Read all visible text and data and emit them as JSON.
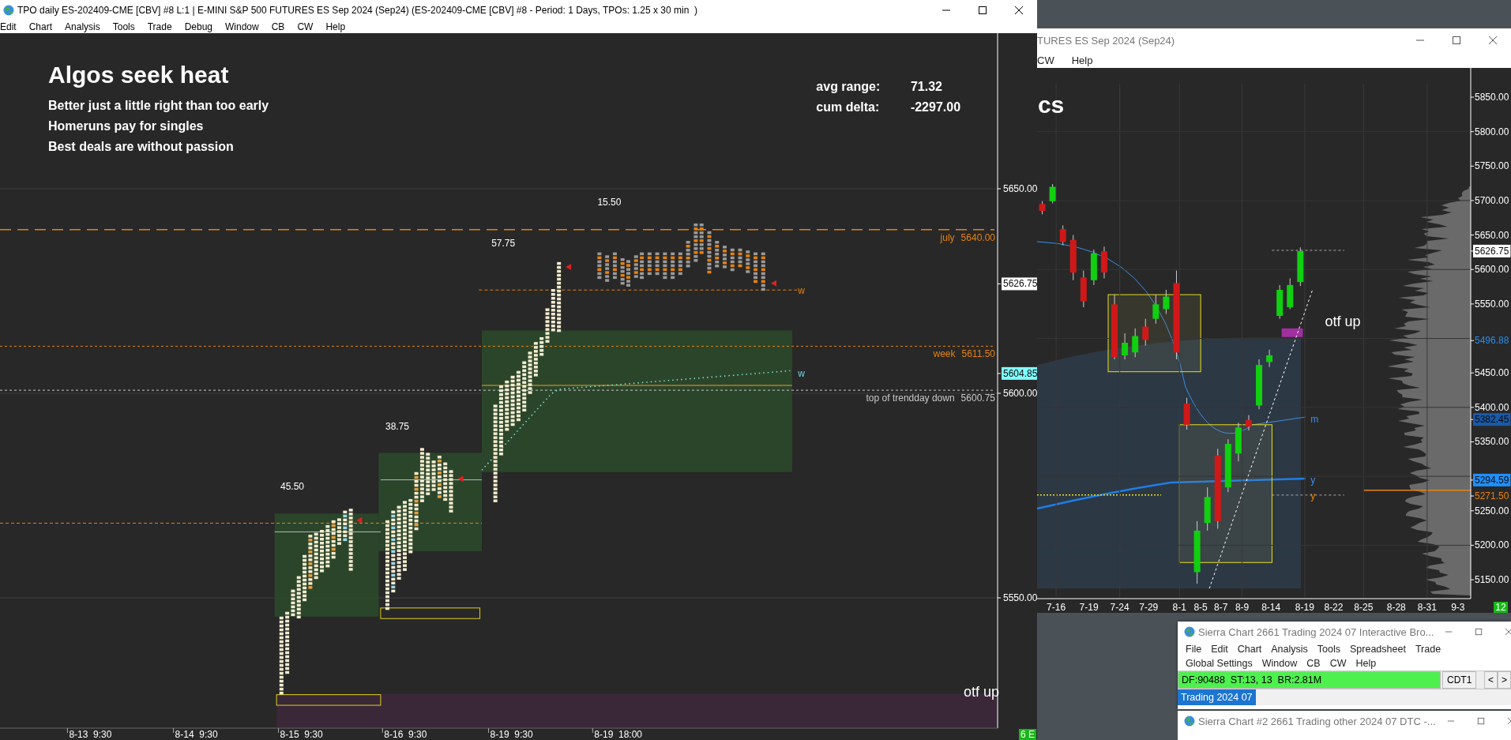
{
  "main_window": {
    "title": "TPO daily ES-202409-CME [CBV] #8 L:1 | E-MINI S&P 500 FUTURES ES Sep 2024 (Sep24) (ES-202409-CME [CBV] #8 - Period: 1 Days, TPOs: 1.25 x 30 min  )",
    "menu": [
      "Edit",
      "Chart",
      "Analysis",
      "Tools",
      "Trade",
      "Debug",
      "Window",
      "CB",
      "CW",
      "Help"
    ],
    "chart": {
      "heading": "Algos seek heat",
      "notes": [
        "Better just a little right than too early",
        "Homeruns pay for singles",
        "Best deals are without passion"
      ],
      "stats": [
        {
          "label": "avg range:",
          "value": "71.32"
        },
        {
          "label": "cum delta:",
          "value": "-2297.00"
        }
      ],
      "range_labels": [
        "15.50",
        "57.75",
        "38.75",
        "45.50"
      ],
      "annotation": "otf up",
      "level_lines": [
        {
          "label": "july",
          "value": "5640.00",
          "kind": "dashed",
          "color": "#e8820c"
        },
        {
          "label": "week",
          "value": "5611.50",
          "kind": "dotted",
          "color": "#e8820c"
        },
        {
          "label": "top of trendday down",
          "value": "5600.75",
          "kind": "dotted",
          "color": "#c8c8c8"
        }
      ],
      "line_tags": [
        {
          "text": "w",
          "color": "#e8820c"
        },
        {
          "text": "w",
          "color": "#6fd8e8"
        }
      ],
      "price_axis": [
        {
          "text": "5650.00",
          "kind": "plain"
        },
        {
          "text": "5626.75",
          "kind": "boxed",
          "color": "#ffffff"
        },
        {
          "text": "5604.85",
          "kind": "boxed",
          "color": "#80ffff"
        },
        {
          "text": "5600.00",
          "kind": "plain"
        },
        {
          "text": "5550.00",
          "kind": "plain"
        }
      ],
      "time_axis": [
        "8-13  9:30",
        "8-14  9:30",
        "8-15  9:30",
        "8-16  9:30",
        "8-19  9:30",
        "8-19  18:00"
      ],
      "badge": "6 E"
    }
  },
  "side_window": {
    "title": "TURES ES Sep 2024 (Sep24)",
    "menu": [
      "CW",
      "Help"
    ],
    "chart": {
      "heading": "cs",
      "annotation": "otf up",
      "chart_data": {
        "type": "candlestick",
        "categories": [
          null,
          null,
          null,
          null,
          null,
          null,
          null,
          null,
          null,
          null,
          null,
          null,
          null,
          null,
          null,
          null,
          null,
          null,
          null,
          null,
          null,
          null,
          null,
          null,
          null,
          null,
          null,
          null,
          null,
          null,
          null,
          null,
          null,
          null,
          null,
          null,
          null,
          null,
          null,
          null,
          null,
          null
        ],
        "ylim": [
          5122.6,
          5892.4
        ],
        "grid": true,
        "yticks": [
          {
            "value": 5850,
            "label": "5850.00"
          },
          {
            "value": 5800,
            "label": "5800.00"
          },
          {
            "value": 5750,
            "label": "5750.00"
          },
          {
            "value": 5700,
            "label": "5700.00"
          },
          {
            "value": 5650,
            "label": "5650.00"
          },
          {
            "value": 5600,
            "label": "5600.00"
          },
          {
            "value": 5550,
            "label": "5550.00"
          },
          {
            "value": 5450,
            "label": "5450.00"
          },
          {
            "value": 5400,
            "label": "5400.00"
          },
          {
            "value": 5350,
            "label": "5350.00"
          },
          {
            "value": 5250,
            "label": "5250.00"
          },
          {
            "value": 5200,
            "label": "5200.00"
          },
          {
            "value": 5150,
            "label": "5150.00"
          }
        ],
        "ohlc": [
          [
            5695,
            5699,
            5680,
            5685
          ],
          [
            5699,
            5724,
            5696,
            5720
          ],
          [
            5658.5,
            5664,
            5635,
            5640
          ],
          [
            5643,
            5650,
            5584.5,
            5595.5
          ],
          [
            5588.5,
            5598.5,
            5545.25,
            5553.75
          ],
          [
            5584.5,
            5629,
            5577.5,
            5623.5
          ],
          [
            5626.25,
            5633.25,
            5587.25,
            5595.75
          ],
          [
            5549.5,
            5563.5,
            5469.75,
            5472.75
          ],
          [
            5475.5,
            5507.5,
            5469.75,
            5493.75
          ],
          [
            5479.75,
            5514.5,
            5472.75,
            5503.5
          ],
          [
            5517.25,
            5528.5,
            5489.5,
            5497.75
          ],
          [
            5528.5,
            5563.5,
            5521.5,
            5549.5
          ],
          [
            5542.5,
            5570.5,
            5535.5,
            5560.75
          ],
          [
            5580.25,
            5598.5,
            5469.75,
            5479.75
          ],
          [
            5405.5,
            5414,
            5367.75,
            5374.75
          ],
          [
            5161,
            5235,
            5144.25,
            5221.25
          ],
          [
            5232.25,
            5284,
            5221.25,
            5270
          ],
          [
            5330.25,
            5340,
            5224,
            5235
          ],
          [
            5284,
            5353.75,
            5277,
            5347
          ],
          [
            5333,
            5377.75,
            5321.75,
            5370.75
          ],
          [
            5381.75,
            5388.75,
            5366.5,
            5372
          ],
          [
            5402.75,
            5469.75,
            5397.25,
            5461.5
          ],
          [
            5465.75,
            5483.75,
            5458.75,
            5475.5
          ],
          [
            5532.75,
            5577.5,
            5528.5,
            5570.5
          ],
          [
            5545.25,
            5587.25,
            5542.5,
            5577.5
          ],
          [
            5581.75,
            5632,
            5576,
            5626.75
          ],
          null,
          null,
          null,
          null,
          null,
          null,
          null,
          null,
          null,
          null,
          null,
          null,
          null,
          null,
          null,
          null
        ]
      },
      "line_tags": [
        {
          "text": "m",
          "color": "#3a8ee6"
        },
        {
          "text": "y",
          "color": "#3a8ee6"
        },
        {
          "text": "y",
          "color": "#e8820c"
        }
      ],
      "price_axis": [
        {
          "text": "5626.75",
          "kind": "boxed",
          "color": "#ffffff"
        },
        {
          "text": "5496.88",
          "kind": "colored",
          "color": "#2a8cf0"
        },
        {
          "text": "5382.45",
          "kind": "boxed",
          "color": "#1a5aa8"
        },
        {
          "text": "5294.59",
          "kind": "boxed",
          "color": "#1e90ff"
        },
        {
          "text": "5271.50",
          "kind": "colored",
          "color": "#e8820c"
        }
      ],
      "date_axis": [
        "7-16",
        "7-19",
        "7-24",
        "7-29",
        "8-1",
        "8-5",
        "8-7",
        "8-9",
        "8-14",
        "8-19",
        "8-22",
        "8-25",
        "8-28",
        "8-31",
        "9-3"
      ],
      "badge": "12"
    }
  },
  "trading_window": {
    "title": "Sierra Chart 2661 Trading 2024 07 Interactive Bro...",
    "menu": [
      "File",
      "Edit",
      "Chart",
      "Analysis",
      "Tools",
      "Spreadsheet",
      "Trade",
      "Global Settings",
      "Window",
      "CB",
      "CW",
      "Help"
    ],
    "status": "DF:90488  ST:13, 13  BR:2.81M",
    "buttons": [
      "CDT1",
      "<",
      ">"
    ],
    "tabs": [
      {
        "label": "Trading 2024 07",
        "selected": true
      }
    ]
  },
  "trading_window_2": {
    "title": "Sierra Chart #2 2661 Trading other 2024 07 DTC -..."
  }
}
